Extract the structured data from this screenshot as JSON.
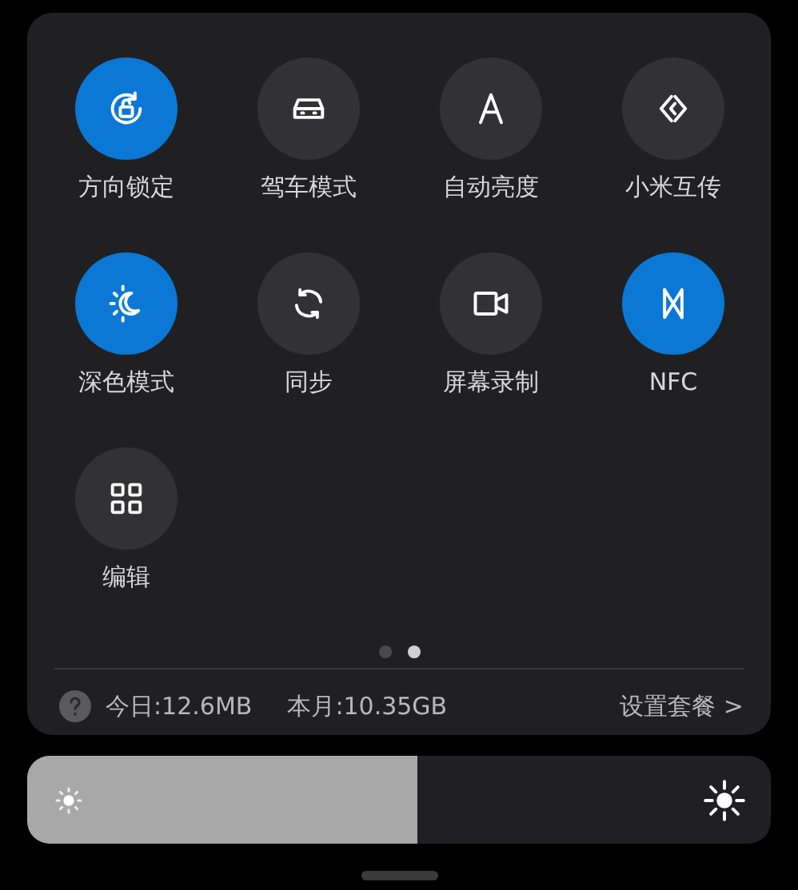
{
  "tiles": [
    {
      "label": "方向锁定",
      "on": true
    },
    {
      "label": "驾车模式",
      "on": false
    },
    {
      "label": "自动亮度",
      "on": false
    },
    {
      "label": "小米互传",
      "on": false
    },
    {
      "label": "深色模式",
      "on": true
    },
    {
      "label": "同步",
      "on": false
    },
    {
      "label": "屏幕录制",
      "on": false
    },
    {
      "label": "NFC",
      "on": true
    },
    {
      "label": "编辑",
      "on": false
    }
  ],
  "pages": [
    {
      "selected": false
    },
    {
      "selected": true
    }
  ],
  "data_usage": {
    "today": "今日:12.6MB",
    "month": "本月:10.35GB",
    "link": "设置套餐 >"
  },
  "brightness": {
    "level": 0.525
  }
}
